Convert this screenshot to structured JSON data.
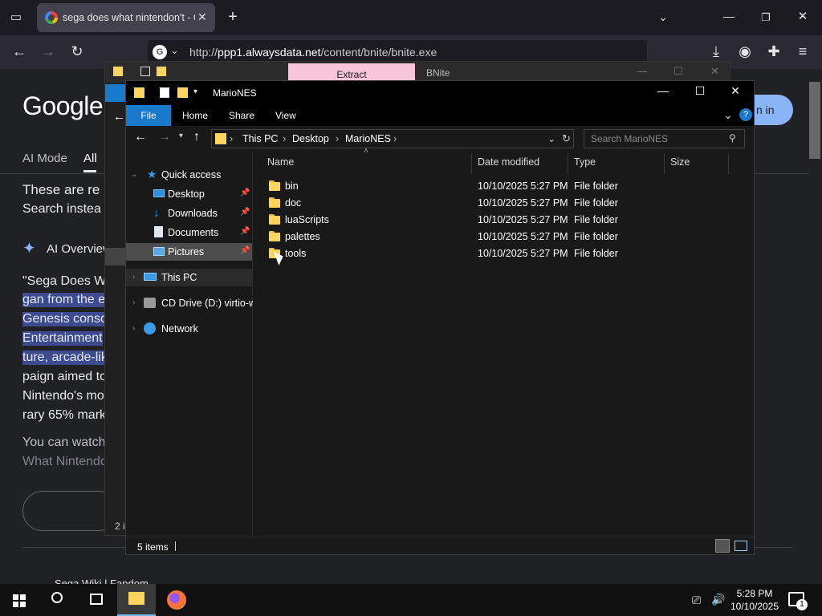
{
  "browser": {
    "tab_title": "sega does what nintendon't - G",
    "url_prefix": "http://",
    "url_domain": "ppp1.alwaysdata.net",
    "url_path": "/content/bnite/bnite.exe"
  },
  "google": {
    "logo": "Google",
    "tabs": [
      "AI Mode",
      "All"
    ],
    "signin": "n in",
    "lines": [
      "These are re",
      "Search instea",
      "AI Overview",
      "\"Sega Does W",
      "gan from the e",
      "Genesis conso",
      "Entertainment",
      "ture, arcade-lik",
      "paign aimed to",
      "Nintendo's mo",
      "rary 65% mark",
      "You can watch",
      "What Nintendo",
      "Sega Wiki | Fandom"
    ]
  },
  "extract_window": {
    "tab_label": "Extract",
    "title": "BNite",
    "status": "2 i"
  },
  "explorer": {
    "title": "MarioNES",
    "ribbon": {
      "file": "File",
      "home": "Home",
      "share": "Share",
      "view": "View"
    },
    "breadcrumb": [
      "This PC",
      "Desktop",
      "MarioNES"
    ],
    "search_placeholder": "Search MarioNES",
    "nav": {
      "quick_access": "Quick access",
      "desktop": "Desktop",
      "downloads": "Downloads",
      "documents": "Documents",
      "pictures": "Pictures",
      "this_pc": "This PC",
      "cd_drive": "CD Drive (D:) virtio-w",
      "network": "Network"
    },
    "columns": {
      "name": "Name",
      "date": "Date modified",
      "type": "Type",
      "size": "Size"
    },
    "files": [
      {
        "name": "bin",
        "date": "10/10/2025 5:27 PM",
        "type": "File folder",
        "size": ""
      },
      {
        "name": "doc",
        "date": "10/10/2025 5:27 PM",
        "type": "File folder",
        "size": ""
      },
      {
        "name": "luaScripts",
        "date": "10/10/2025 5:27 PM",
        "type": "File folder",
        "size": ""
      },
      {
        "name": "palettes",
        "date": "10/10/2025 5:27 PM",
        "type": "File folder",
        "size": ""
      },
      {
        "name": "tools",
        "date": "10/10/2025 5:27 PM",
        "type": "File folder",
        "size": ""
      }
    ],
    "status_count": "5 items"
  },
  "taskbar": {
    "time": "5:28 PM",
    "date": "10/10/2025",
    "notification_count": "1"
  }
}
